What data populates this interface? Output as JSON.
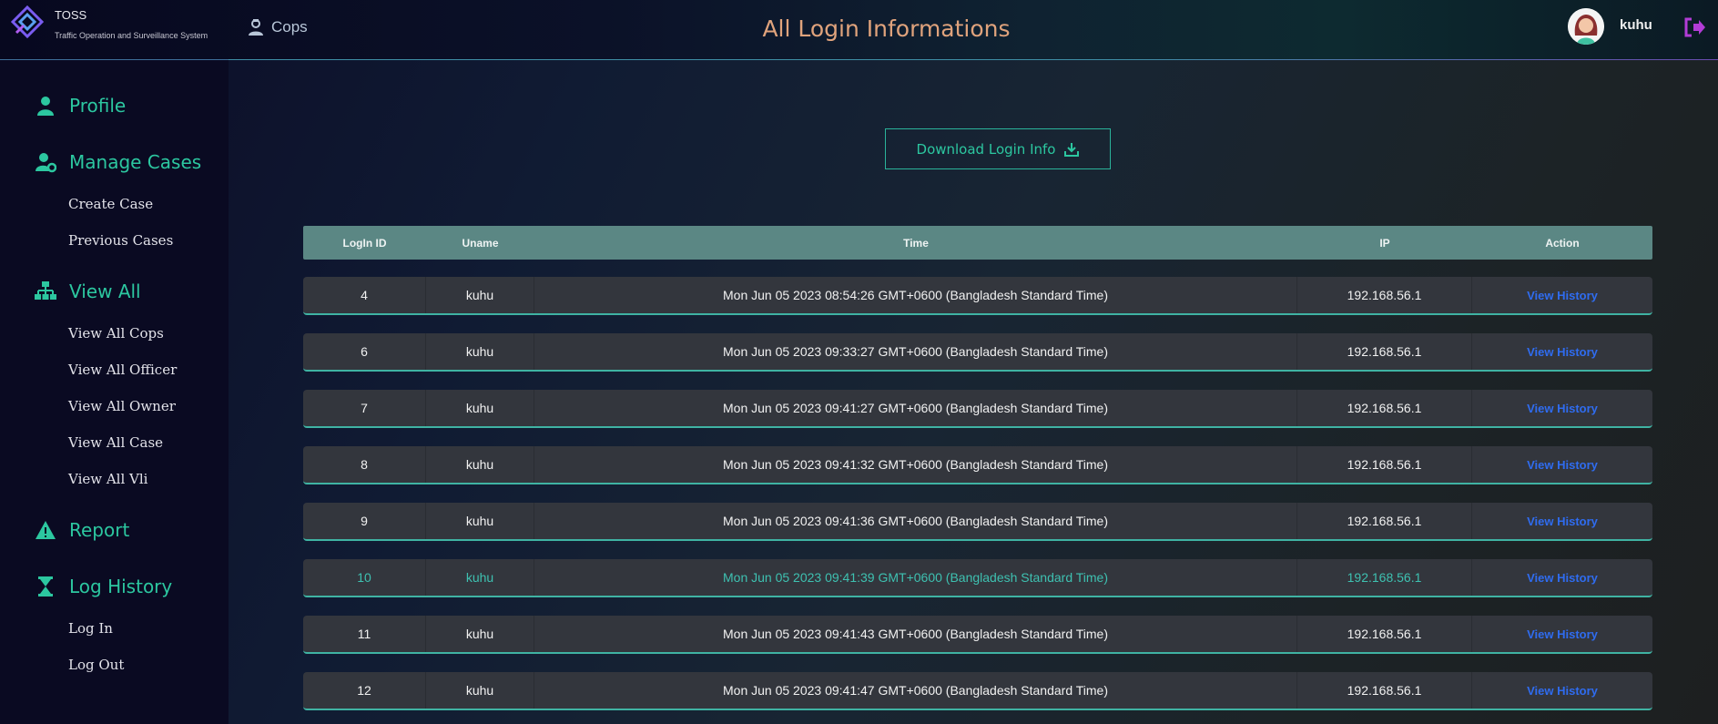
{
  "brand": {
    "title": "TOSS",
    "subtitle": "Traffic Operation and Surveillance System"
  },
  "header": {
    "section": "Cops",
    "page_title": "All Login Informations",
    "user": "kuhu"
  },
  "sidebar": {
    "groups": [
      {
        "label": "Profile",
        "icon": "user-icon",
        "items": []
      },
      {
        "label": "Manage Cases",
        "icon": "user-gear-icon",
        "items": [
          "Create Case",
          "Previous Cases"
        ]
      },
      {
        "label": "View All",
        "icon": "sitemap-icon",
        "items": [
          "View All Cops",
          "View All Officer",
          "View All Owner",
          "View All Case",
          "View All Vli"
        ]
      },
      {
        "label": "Report",
        "icon": "warning-icon",
        "items": []
      },
      {
        "label": "Log History",
        "icon": "hourglass-icon",
        "items": [
          "Log In",
          "Log Out"
        ]
      }
    ]
  },
  "main": {
    "download_label": "Download Login Info",
    "table": {
      "headers": [
        "LogIn ID",
        "Uname",
        "Time",
        "IP",
        "Action"
      ],
      "rows": [
        {
          "id": "4",
          "uname": "kuhu",
          "time": "Mon Jun 05 2023 08:54:26 GMT+0600 (Bangladesh Standard Time)",
          "ip": "192.168.56.1",
          "action": "View History"
        },
        {
          "id": "6",
          "uname": "kuhu",
          "time": "Mon Jun 05 2023 09:33:27 GMT+0600 (Bangladesh Standard Time)",
          "ip": "192.168.56.1",
          "action": "View History"
        },
        {
          "id": "7",
          "uname": "kuhu",
          "time": "Mon Jun 05 2023 09:41:27 GMT+0600 (Bangladesh Standard Time)",
          "ip": "192.168.56.1",
          "action": "View History"
        },
        {
          "id": "8",
          "uname": "kuhu",
          "time": "Mon Jun 05 2023 09:41:32 GMT+0600 (Bangladesh Standard Time)",
          "ip": "192.168.56.1",
          "action": "View History"
        },
        {
          "id": "9",
          "uname": "kuhu",
          "time": "Mon Jun 05 2023 09:41:36 GMT+0600 (Bangladesh Standard Time)",
          "ip": "192.168.56.1",
          "action": "View History"
        },
        {
          "id": "10",
          "uname": "kuhu",
          "time": "Mon Jun 05 2023 09:41:39 GMT+0600 (Bangladesh Standard Time)",
          "ip": "192.168.56.1",
          "action": "View History"
        },
        {
          "id": "11",
          "uname": "kuhu",
          "time": "Mon Jun 05 2023 09:41:43 GMT+0600 (Bangladesh Standard Time)",
          "ip": "192.168.56.1",
          "action": "View History"
        },
        {
          "id": "12",
          "uname": "kuhu",
          "time": "Mon Jun 05 2023 09:41:47 GMT+0600 (Bangladesh Standard Time)",
          "ip": "192.168.56.1",
          "action": "View History"
        }
      ]
    }
  },
  "colors": {
    "accent": "#2cc7a0",
    "title": "#e0a37c",
    "link": "#2f6cf0",
    "header_row": "#5b8784",
    "row_bg": "#33363d",
    "highlight_text": "#3ec1b1",
    "logout": "#b23cd6"
  }
}
